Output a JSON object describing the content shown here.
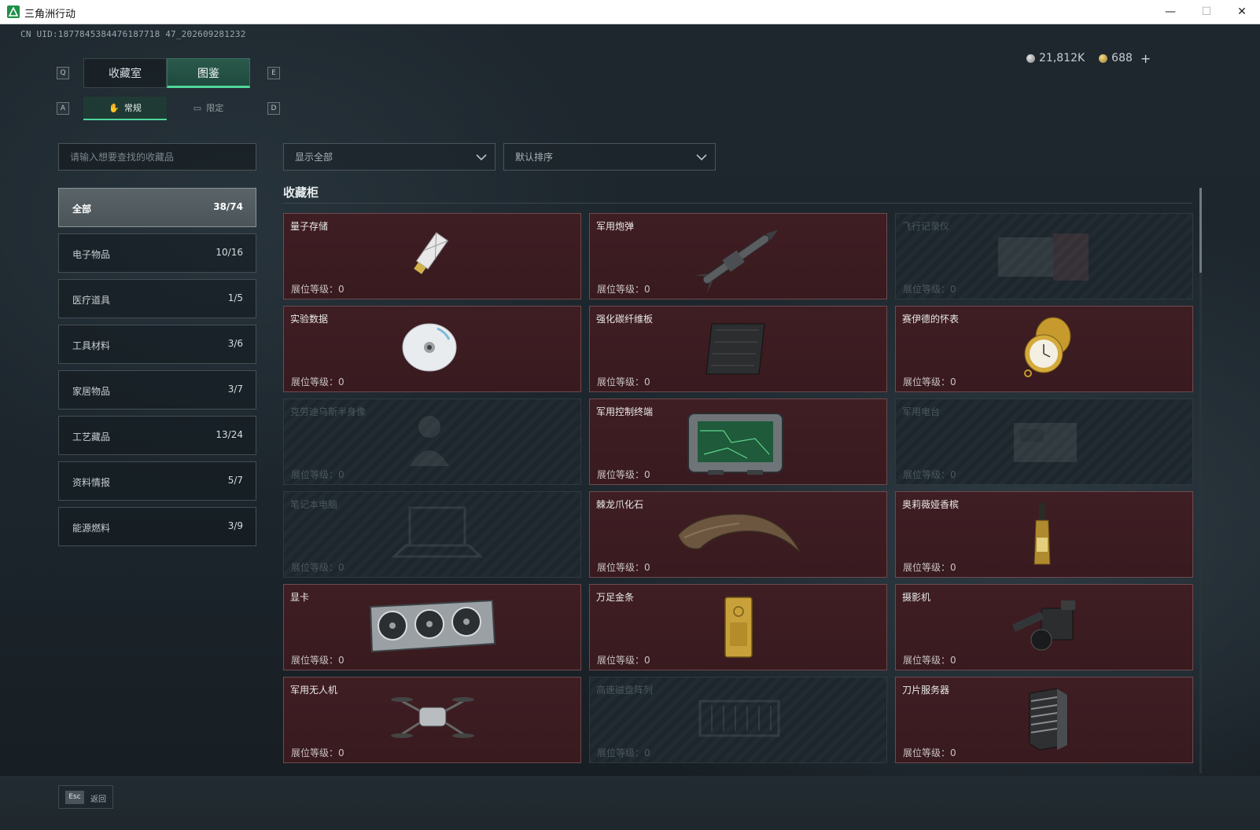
{
  "window": {
    "title": "三角洲行动",
    "min": "—",
    "max": "☐",
    "close": "✕"
  },
  "uid": "CN UID:1877845384476187718 47_202609281232",
  "currency": {
    "silver": "21,812K",
    "gold": "688",
    "add": "+"
  },
  "tabs": {
    "prev_key": "Q",
    "next_key": "E",
    "items": [
      {
        "label": "收藏室"
      },
      {
        "label": "图鉴"
      }
    ],
    "sub_prev_key": "A",
    "sub_next_key": "D",
    "sub_items": [
      {
        "label": "常规"
      },
      {
        "label": "限定"
      }
    ]
  },
  "search": {
    "placeholder": "请输入想要查找的收藏品"
  },
  "filters": {
    "show": "显示全部",
    "sort": "默认排序"
  },
  "categories": [
    {
      "name": "全部",
      "count": "38/74"
    },
    {
      "name": "电子物品",
      "count": "10/16"
    },
    {
      "name": "医疗道具",
      "count": "1/5"
    },
    {
      "name": "工具材料",
      "count": "3/6"
    },
    {
      "name": "家居物品",
      "count": "3/7"
    },
    {
      "name": "工艺藏品",
      "count": "13/24"
    },
    {
      "name": "资料情报",
      "count": "5/7"
    },
    {
      "name": "能源燃料",
      "count": "3/9"
    }
  ],
  "section_title": "收藏柜",
  "level_label": "展位等级：0",
  "items": [
    {
      "name": "量子存储",
      "icon": "usb-drive-icon",
      "locked": false
    },
    {
      "name": "军用炮弹",
      "icon": "missile-icon",
      "locked": false
    },
    {
      "name": "飞行记录仪",
      "icon": "flight-recorder-icon",
      "locked": true
    },
    {
      "name": "实验数据",
      "icon": "disc-icon",
      "locked": false
    },
    {
      "name": "强化碳纤维板",
      "icon": "carbon-plate-icon",
      "locked": false
    },
    {
      "name": "赛伊德的怀表",
      "icon": "pocket-watch-icon",
      "locked": false
    },
    {
      "name": "克劳迪乌斯半身像",
      "icon": "bust-icon",
      "locked": true
    },
    {
      "name": "军用控制终端",
      "icon": "control-terminal-icon",
      "locked": false
    },
    {
      "name": "军用电台",
      "icon": "radio-icon",
      "locked": true
    },
    {
      "name": "笔记本电脑",
      "icon": "laptop-icon",
      "locked": true
    },
    {
      "name": "棘龙爪化石",
      "icon": "claw-fossil-icon",
      "locked": false
    },
    {
      "name": "奥莉薇娅香槟",
      "icon": "champagne-icon",
      "locked": false
    },
    {
      "name": "显卡",
      "icon": "graphics-card-icon",
      "locked": false
    },
    {
      "name": "万足金条",
      "icon": "gold-bar-icon",
      "locked": false
    },
    {
      "name": "摄影机",
      "icon": "camera-icon",
      "locked": false
    },
    {
      "name": "军用无人机",
      "icon": "drone-icon",
      "locked": false
    },
    {
      "name": "高速磁盘阵列",
      "icon": "disk-array-icon",
      "locked": true
    },
    {
      "name": "刀片服务器",
      "icon": "blade-server-icon",
      "locked": false
    }
  ],
  "footer": {
    "esc_key": "Esc",
    "back_label": "返回"
  },
  "colors": {
    "accent": "#4fd69a",
    "card_owned": "#3f1e23",
    "card_locked": "#1c262c"
  }
}
